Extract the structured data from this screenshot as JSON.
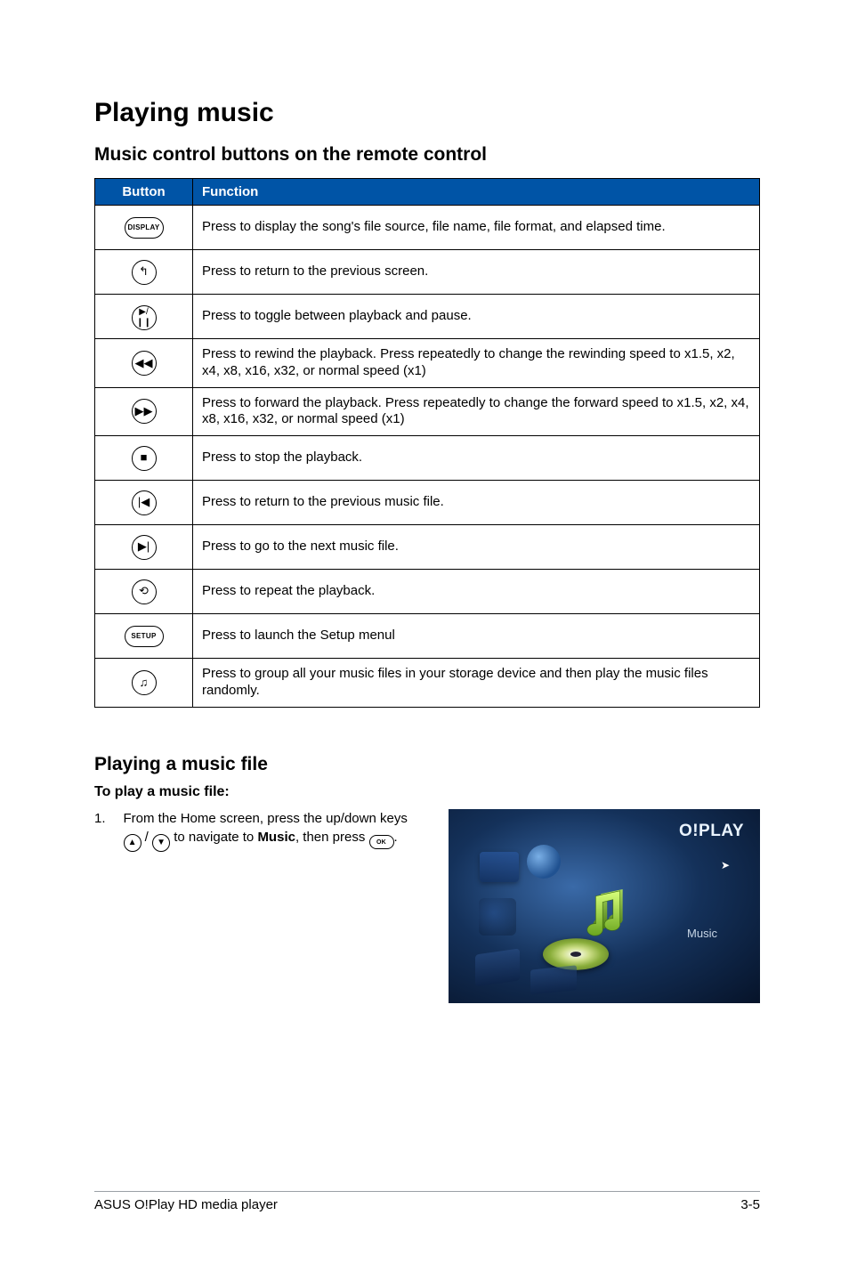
{
  "title": "Playing music",
  "section1_title": "Music control buttons on the remote control",
  "table": {
    "head": {
      "button": "Button",
      "function": "Function"
    },
    "rows": [
      {
        "icon_label": "DISPLAY",
        "func": "Press to display the song's file source, file name, file format, and elapsed time."
      },
      {
        "icon_label": "↰",
        "func": "Press to return to the previous screen."
      },
      {
        "icon_label": "▶/❙❙",
        "func": "Press to toggle between playback and pause."
      },
      {
        "icon_label": "◀◀",
        "func": "Press to rewind the playback. Press repeatedly to change the rewinding speed to x1.5, x2, x4, x8, x16, x32, or normal speed (x1)"
      },
      {
        "icon_label": "▶▶",
        "func": "Press to forward the playback. Press repeatedly to change the forward speed to x1.5, x2, x4, x8, x16, x32, or normal speed (x1)"
      },
      {
        "icon_label": "■",
        "func": "Press to stop the playback."
      },
      {
        "icon_label": "|◀",
        "func": "Press to return to the previous music file."
      },
      {
        "icon_label": "▶|",
        "func": "Press to go to the next music file."
      },
      {
        "icon_label": "⟲",
        "func": "Press to repeat the playback."
      },
      {
        "icon_label": "SETUP",
        "func": "Press to launch the Setup menul"
      },
      {
        "icon_label": "♫",
        "func": "Press to group all your music files in your storage device and then play the music files randomly."
      }
    ]
  },
  "section2_title": "Playing a music file",
  "section2_sub": "To play a music file:",
  "step": {
    "num": "1.",
    "text_before": "From the Home screen, press the up/down keys ",
    "text_mid": " / ",
    "text_after_nav": " to navigate to ",
    "music_label": "Music",
    "text_then": ", then press ",
    "ok_label": "OK",
    "period": "."
  },
  "screenshot": {
    "logo": "O!PLAY",
    "menu_item": "Music"
  },
  "footer": {
    "left": "ASUS O!Play HD media player",
    "right": "3-5"
  }
}
